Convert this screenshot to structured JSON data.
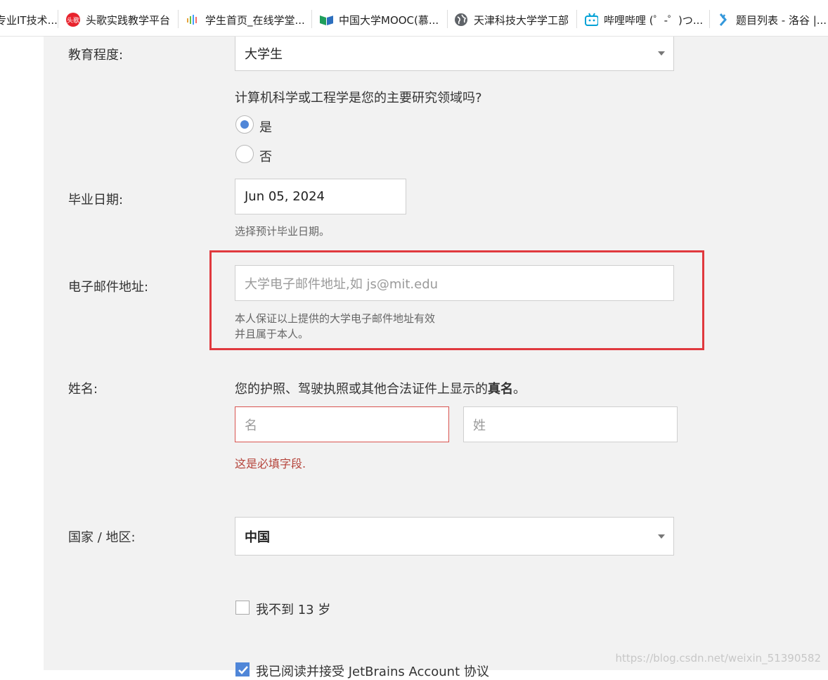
{
  "bookmarks": [
    {
      "label": "专业IT技术...",
      "icon": "site-icon"
    },
    {
      "label": "头歌实践教学平台",
      "icon": "toutiao-logo-icon"
    },
    {
      "label": "学生首页_在线学堂...",
      "icon": "waveform-icon"
    },
    {
      "label": "中国大学MOOC(慕...",
      "icon": "mooc-book-icon"
    },
    {
      "label": "天津科技大学学工部",
      "icon": "globe-icon"
    },
    {
      "label": "哔哩哔哩 (゜-゜)つ...",
      "icon": "bilibili-tv-icon"
    },
    {
      "label": "题目列表 - 洛谷 |...",
      "icon": "luogu-icon"
    }
  ],
  "form": {
    "education": {
      "label": "教育程度:",
      "value": "大学生"
    },
    "cs_question": {
      "text": "计算机科学或工程学是您的主要研究领域吗?",
      "yes": "是",
      "no": "否",
      "selected": "yes"
    },
    "graduation": {
      "label": "毕业日期:",
      "value": "Jun 05, 2024",
      "hint": "选择预计毕业日期。"
    },
    "email": {
      "label": "电子邮件地址:",
      "placeholder": "大学电子邮件地址,如 js@mit.edu",
      "value": "",
      "hint_line1": "本人保证以上提供的大学电子邮件地址有效",
      "hint_line2": "并且属于本人。"
    },
    "name": {
      "label": "姓名:",
      "desc_prefix": "您的护照、驾驶执照或其他合法证件上显示的",
      "desc_bold": "真名",
      "desc_suffix": "。",
      "first_placeholder": "名",
      "last_placeholder": "姓",
      "error": "这是必填字段."
    },
    "country": {
      "label": "国家 / 地区:",
      "value": "中国"
    },
    "under13": {
      "label": "我不到 13 岁",
      "checked": false
    },
    "agree": {
      "label": "我已阅读并接受 JetBrains Account 协议",
      "checked": true
    }
  },
  "colors": {
    "accent": "#4f86d8",
    "highlight_border": "#e0393e",
    "error": "#b5443b"
  },
  "watermark": "https://blog.csdn.net/weixin_51390582"
}
